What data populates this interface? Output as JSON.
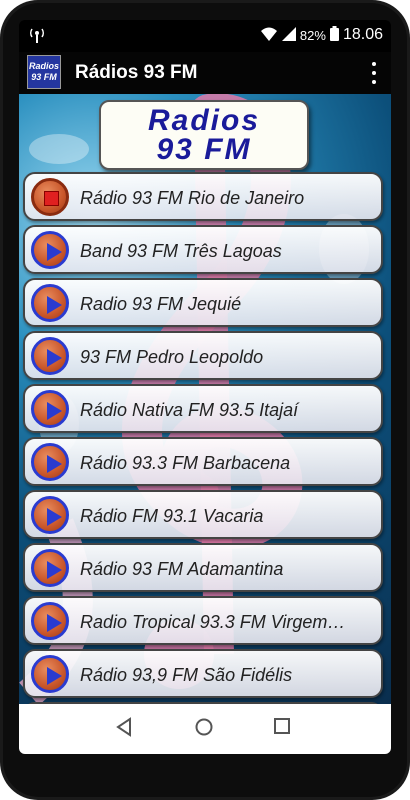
{
  "status": {
    "battery": "82%",
    "time": "18.06"
  },
  "appbar": {
    "icon_line1": "Radios",
    "icon_line2": "93 FM",
    "title": "Rádios 93 FM"
  },
  "banner": {
    "line1": "Radios",
    "line2": "93 FM"
  },
  "stations": [
    {
      "name": "Rádio 93 FM Rio de Janeiro",
      "state": "stop"
    },
    {
      "name": "Band 93 FM Três Lagoas",
      "state": "play"
    },
    {
      "name": "Radio 93 FM Jequié",
      "state": "play"
    },
    {
      "name": "93 FM Pedro Leopoldo",
      "state": "play"
    },
    {
      "name": "Rádio Nativa FM 93.5 Itajaí",
      "state": "play"
    },
    {
      "name": "Rádio 93.3 FM Barbacena",
      "state": "play"
    },
    {
      "name": "Rádio FM 93.1 Vacaria",
      "state": "play"
    },
    {
      "name": "Rádio 93 FM Adamantina",
      "state": "play"
    },
    {
      "name": "Radio Tropical 93.3 FM Virgem…",
      "state": "play"
    },
    {
      "name": "Rádio 93,9 FM São Fidélis",
      "state": "play"
    }
  ],
  "icons": {
    "status_left": "broadcast-icon",
    "wifi": "wifi-icon",
    "signal": "signal-icon",
    "battery": "battery-icon",
    "overflow": "more-vert-icon",
    "nav_back": "back-icon",
    "nav_home": "home-icon",
    "nav_recent": "recents-icon"
  },
  "colors": {
    "appbar": "#050505",
    "banner_text": "#1a1b9a",
    "button_ring": "#2a3bd0",
    "button_fill": "#c9562a"
  }
}
